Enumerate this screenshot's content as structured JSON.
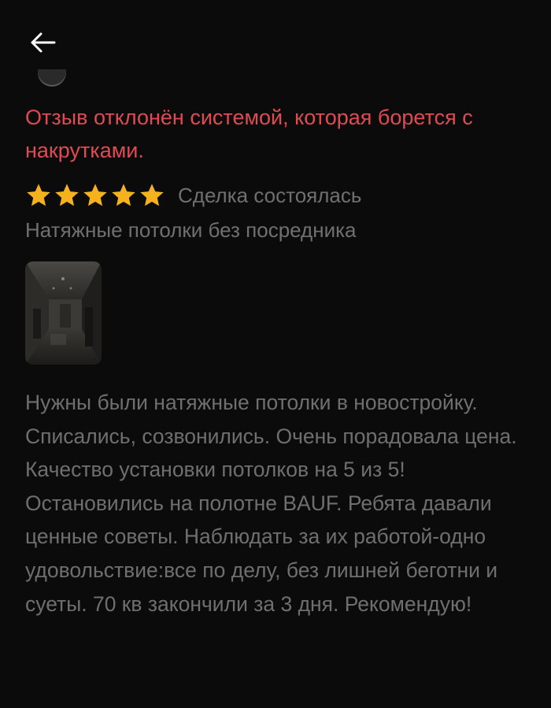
{
  "header": {
    "back_icon": "arrow-left-icon"
  },
  "review": {
    "rejection_notice": "Отзыв отклонён системой, которая борется с накрутками.",
    "rating": {
      "stars_filled": 5,
      "stars_total": 5,
      "star_color": "#f5b21c"
    },
    "deal_status": "Сделка состоялась",
    "company": "Натяжные потолки без посредника",
    "photo_icon": "review-photo-thumbnail",
    "text": "Нужны были натяжные потолки в новостройку. Списались, созвонились. Очень порадовала цена. Качество установки потолков на 5 из 5! Остановились  на полотне BAUF. Ребята давали ценные советы. Наблюдать за их работой-одно удовольствие:все по делу, без лишней беготни и суеты. 70 кв закончили за 3 дня. Рекомендую!"
  },
  "colors": {
    "background": "#0b0b0b",
    "rejection_text": "#e24a52",
    "muted_text": "#707070"
  }
}
